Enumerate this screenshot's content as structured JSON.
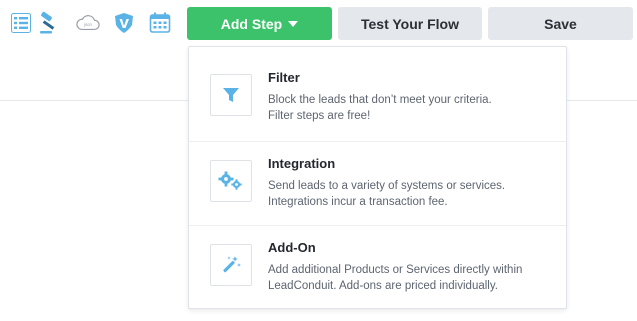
{
  "colors": {
    "accent_green": "#3cc26b",
    "icon_blue": "#5ab3e6",
    "button_gray": "#e4e7eb"
  },
  "toolbar": {
    "icons": [
      "list-icon",
      "gavel-icon",
      "cloud-icon",
      "vimeo-icon",
      "calendar-icon"
    ],
    "add_step_label": "Add Step",
    "test_flow_label": "Test Your Flow",
    "save_label": "Save"
  },
  "dropdown": {
    "items": [
      {
        "title": "Filter",
        "icon": "funnel-icon",
        "description_lines": [
          "Block the leads that don’t meet your criteria.",
          "Filter steps are free!"
        ]
      },
      {
        "title": "Integration",
        "icon": "gears-icon",
        "description_lines": [
          "Send leads to a variety of systems or services.",
          "Integrations incur a transaction fee."
        ]
      },
      {
        "title": "Add-On",
        "icon": "magic-wand-icon",
        "description_lines": [
          "Add additional Products or Services directly within",
          "LeadConduit. Add-ons are priced individually."
        ]
      }
    ]
  }
}
